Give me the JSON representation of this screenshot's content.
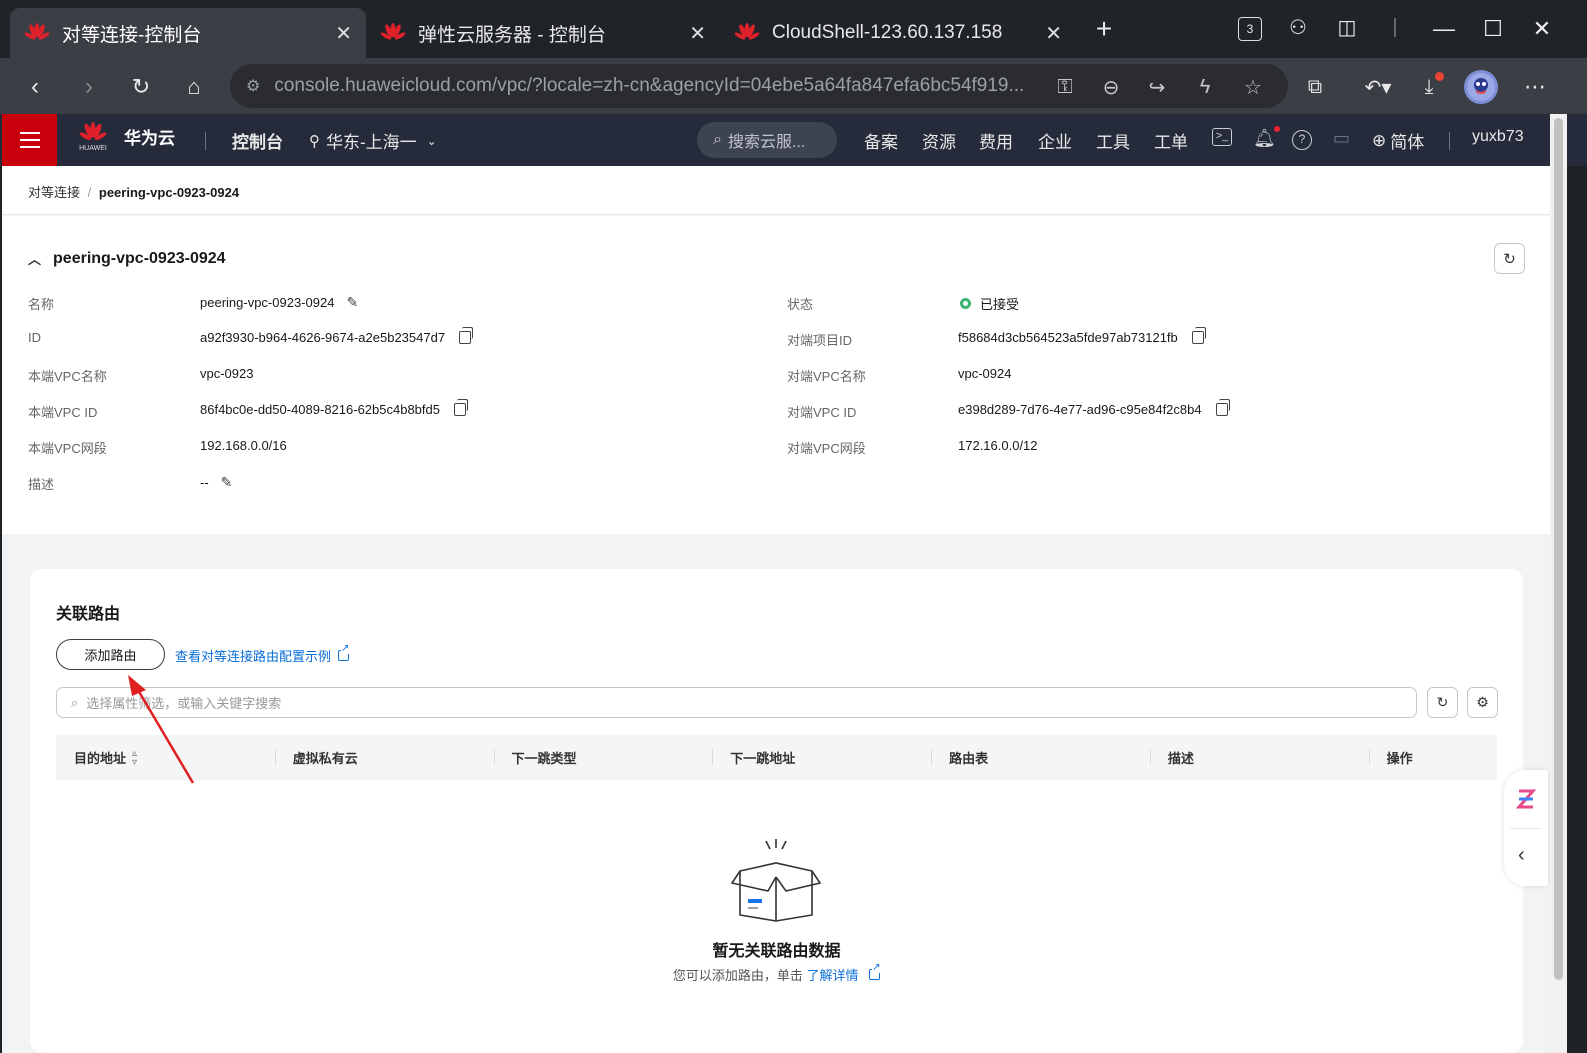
{
  "browser": {
    "tabs": [
      {
        "title": "对等连接-控制台",
        "active": true
      },
      {
        "title": "弹性云服务器 - 控制台",
        "active": false
      },
      {
        "title": "CloudShell-123.60.137.158",
        "active": false
      }
    ],
    "tab_count_badge": "3",
    "url": "console.huaweicloud.com/vpc/?locale=zh-cn&agencyId=04ebe5a64fa847efa6bc54f919..."
  },
  "console_header": {
    "brand": "华为云",
    "logo_text": "HUAWEI",
    "console_link": "控制台",
    "region": "华东-上海一",
    "search_placeholder": "搜索云服...",
    "nav": [
      "备案",
      "资源",
      "费用",
      "企业",
      "工具",
      "工单"
    ],
    "language": "简体",
    "username": "yuxb73"
  },
  "breadcrumb": {
    "parent": "对等连接",
    "current": "peering-vpc-0923-0924"
  },
  "detail": {
    "title": "peering-vpc-0923-0924",
    "left_fields": [
      {
        "label": "名称",
        "value": "peering-vpc-0923-0924",
        "action": "edit"
      },
      {
        "label": "ID",
        "value": "a92f3930-b964-4626-9674-a2e5b23547d7",
        "action": "copy"
      },
      {
        "label": "本端VPC名称",
        "value": "vpc-0923",
        "action": ""
      },
      {
        "label": "本端VPC ID",
        "value": "86f4bc0e-dd50-4089-8216-62b5c4b8bfd5",
        "action": "copy"
      },
      {
        "label": "本端VPC网段",
        "value": "192.168.0.0/16",
        "action": ""
      },
      {
        "label": "描述",
        "value": "--",
        "action": "edit"
      }
    ],
    "right_fields": [
      {
        "label": "状态",
        "value": "已接受",
        "action": "status"
      },
      {
        "label": "对端项目ID",
        "value": "f58684d3cb564523a5fde97ab73121fb",
        "action": "copy"
      },
      {
        "label": "对端VPC名称",
        "value": "vpc-0924",
        "action": ""
      },
      {
        "label": "对端VPC ID",
        "value": "e398d289-7d76-4e77-ad96-c95e84f2c8b4",
        "action": "copy"
      },
      {
        "label": "对端VPC网段",
        "value": "172.16.0.0/12",
        "action": ""
      }
    ]
  },
  "routes": {
    "title": "关联路由",
    "add_button": "添加路由",
    "example_link": "查看对等连接路由配置示例",
    "filter_placeholder": "选择属性筛选，或输入关键字搜索",
    "columns": [
      "目的地址",
      "虚拟私有云",
      "下一跳类型",
      "下一跳地址",
      "路由表",
      "描述",
      "操作"
    ],
    "empty_title": "暂无关联路由数据",
    "empty_sub": "您可以添加路由，单击",
    "empty_link": "了解详情"
  },
  "colors": {
    "accent_red": "#c7000b",
    "link_blue": "#0a6fd8",
    "status_green": "#3cb371",
    "annotation_arrow": "#e02020"
  }
}
